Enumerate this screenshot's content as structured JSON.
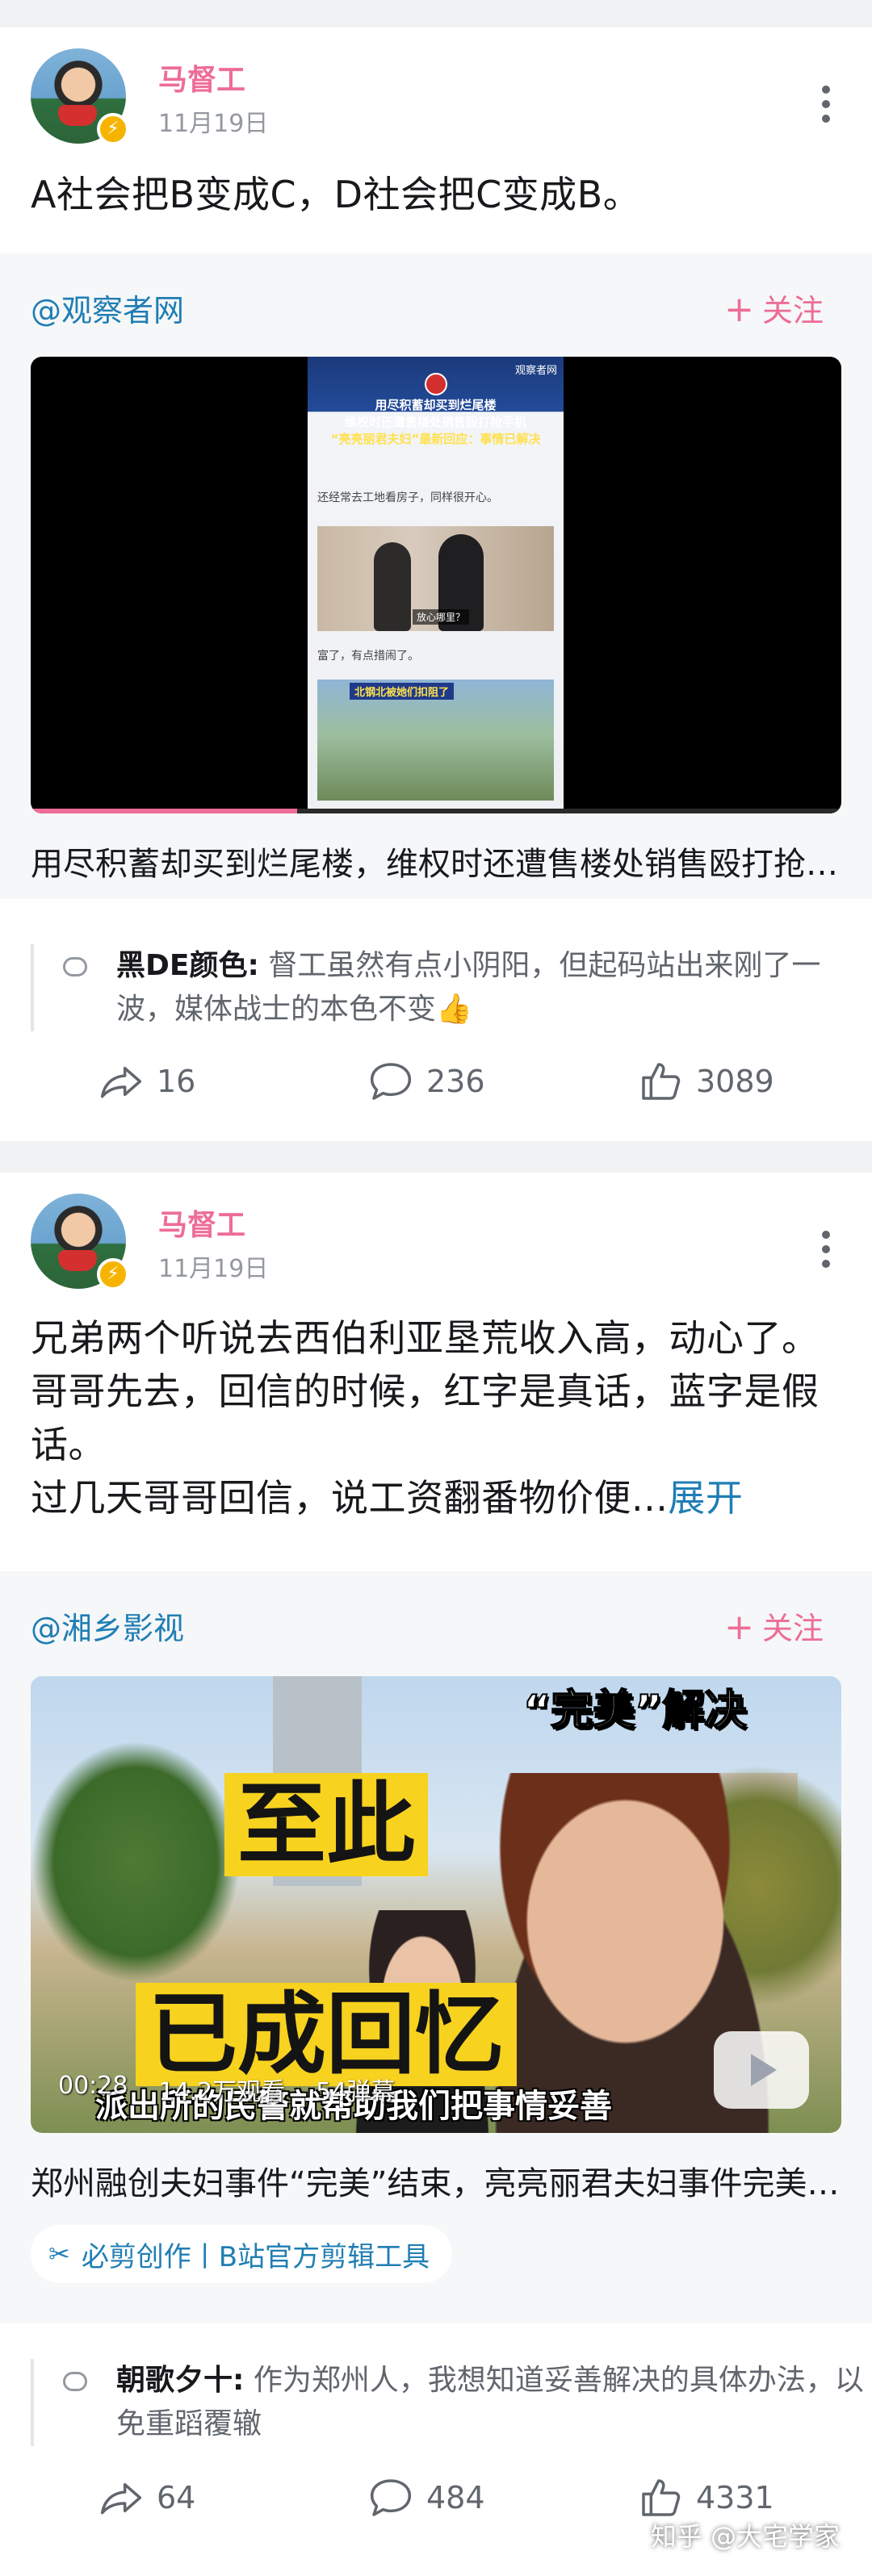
{
  "posts": [
    {
      "author": "马督工",
      "date": "11月19日",
      "text": "A社会把B变成C，D社会把C变成B。",
      "repost": {
        "author": "@观察者网",
        "follow_label": "关注",
        "video": {
          "title": "用尽积蓄却买到烂尾楼，维权时还遭售楼处销售殴打抢手机",
          "thumb_lines": [
            "用尽积蓄却买到烂尾楼",
            "维权时还遭售楼处销售殴打抢手机",
            "“亮亮丽君夫妇”最新回应：事情已解决"
          ],
          "thumb_source": "观察者网",
          "thumb_text1": "还经常去工地看房子，同样很开心。",
          "thumb_caption1": "放心哪里？",
          "thumb_text2": "富了，有点措闹了。",
          "thumb_caption2": "北钢北被她们扣阻了"
        }
      },
      "comment": {
        "name": "黑DE颜色:",
        "text": "督工虽然有点小阴阳，但起码站出来刚了一波，媒体战士的本色不变👍"
      },
      "actions": {
        "share": "16",
        "comment": "236",
        "like": "3089"
      }
    },
    {
      "author": "马督工",
      "date": "11月19日",
      "text": "兄弟两个听说去西伯利亚垦荒收入高，动心了。哥哥先去，回信的时候，红字是真话，蓝字是假话。",
      "text2": "过几天哥哥回信，说工资翻番物价便...",
      "expand_label": "展开",
      "repost": {
        "author": "@湘乡影视",
        "follow_label": "关注",
        "video": {
          "title": "郑州融创夫妇事件“完美”结束，亮亮丽君夫妇事件完美解决",
          "caption_top": "“完美”解决",
          "caption_big1": "至此",
          "caption_big2": "已成回忆",
          "subtitle": "派出所的民警就帮助我们把事情妥善",
          "duration": "00:28",
          "views": "14.2万观看",
          "danmaku": "54弹幕"
        },
        "tool": "必剪创作丨B站官方剪辑工具"
      },
      "comment": {
        "name": "朝歌夕十:",
        "text": "作为郑州人，我想知道妥善解决的具体办法，以免重蹈覆辙"
      },
      "actions": {
        "share": "64",
        "comment": "484",
        "like": "4331"
      }
    }
  ],
  "watermark": "知乎 @大宅学家",
  "colors": {
    "accent_pink": "#ed6d97",
    "link_blue": "#1f7eb4",
    "text_gray": "#61666d"
  }
}
